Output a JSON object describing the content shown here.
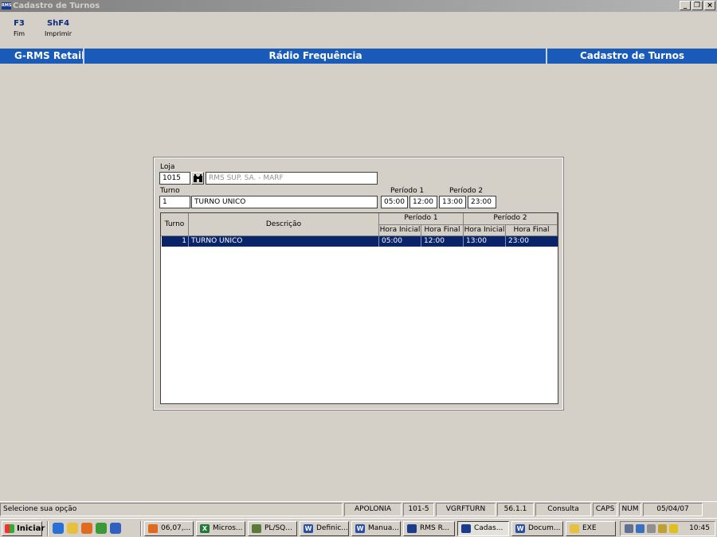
{
  "window": {
    "title": "Cadastro de Turnos",
    "app_icon_text": "RMS",
    "minimize": "_",
    "restore": "❐",
    "close": "×"
  },
  "function_keys": [
    {
      "key": "F3",
      "label": "Fim"
    },
    {
      "key": "ShF4",
      "label": "Imprimir"
    }
  ],
  "band": {
    "left": "G-RMS Retail",
    "center": "Rádio Frequência",
    "right": "Cadastro de Turnos"
  },
  "form": {
    "loja_label": "Loja",
    "loja_value": "1015",
    "loja_desc": "RMS SUP. SA. - MARF",
    "turno_label": "Turno",
    "turno_value": "1",
    "turno_desc": "TURNO UNICO",
    "periodo1_label": "Período 1",
    "periodo2_label": "Período 2",
    "p1_inicio": "05:00",
    "p1_fim": "12:00",
    "p2_inicio": "13:00",
    "p2_fim": "23:00"
  },
  "grid": {
    "headers": {
      "turno": "Turno",
      "descricao": "Descrição",
      "periodo1": "Período 1",
      "periodo2": "Período 2",
      "hora_inicial": "Hora Inicial",
      "hora_final": "Hora Final"
    },
    "rows": [
      {
        "turno": "1",
        "descricao": "TURNO UNICO",
        "p1_ini": "05:00",
        "p1_fim": "12:00",
        "p2_ini": "13:00",
        "p2_fim": "23:00"
      }
    ]
  },
  "status": {
    "message": "Selecione sua opção",
    "server": "APOLONIA",
    "code": "101-5",
    "program": "VGRFTURN",
    "version": "56.1.1",
    "mode": "Consulta",
    "caps": "CAPS",
    "num": "NUM",
    "date": "05/04/07"
  },
  "taskbar": {
    "start": "Iniciar",
    "items": [
      "06,07,...",
      "Micros...",
      "PL/SQ...",
      "Definic...",
      "Manua...",
      "RMS R...",
      "Cadas...",
      "Docum...",
      "EXE"
    ],
    "clock": "10:45"
  },
  "colors": {
    "band": "#1a5ab8",
    "selection": "#0a246a",
    "face": "#d4d0c8"
  }
}
